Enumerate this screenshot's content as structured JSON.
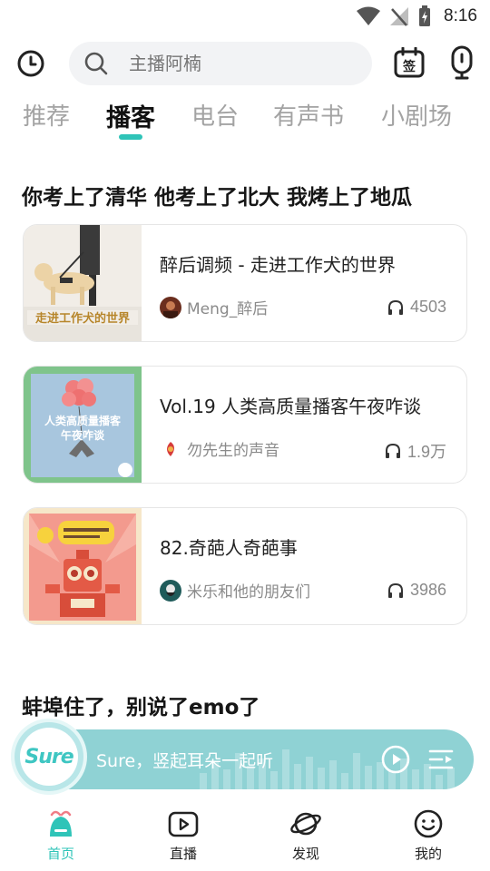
{
  "status_bar": {
    "time": "8:16"
  },
  "search": {
    "placeholder": "主播阿楠"
  },
  "header": {
    "sign_icon_text": "签"
  },
  "tabs": [
    {
      "label": "推荐",
      "active": false
    },
    {
      "label": "播客",
      "active": true
    },
    {
      "label": "电台",
      "active": false
    },
    {
      "label": "有声书",
      "active": false
    },
    {
      "label": "小剧场",
      "active": false
    }
  ],
  "sections": [
    {
      "title": "你考上了清华 他考上了北大 我烤上了地瓜",
      "items": [
        {
          "title": "醉后调频 - 走进工作犬的世界",
          "author": "Meng_醉后",
          "plays": "4503",
          "cover_text": "走进工作犬的世界"
        },
        {
          "title": "Vol.19 人类高质量播客午夜咋谈",
          "author": "勿先生的声音",
          "plays": "1.9万",
          "cover_text": "人类高质量播客午夜咋谈"
        },
        {
          "title": "82.奇葩人奇葩事",
          "author": "米乐和他的朋友们",
          "plays": "3986",
          "cover_text": ""
        }
      ]
    },
    {
      "title": "蚌埠住了，别说了emo了",
      "items": []
    }
  ],
  "player": {
    "logo_text": "Sure",
    "text": "Sure，竖起耳朵一起听"
  },
  "bottom_nav": [
    {
      "label": "首页",
      "icon": "home-icon",
      "active": true
    },
    {
      "label": "直播",
      "icon": "live-icon",
      "active": false
    },
    {
      "label": "发现",
      "icon": "planet-icon",
      "active": false
    },
    {
      "label": "我的",
      "icon": "smile-icon",
      "active": false
    }
  ],
  "colors": {
    "accent": "#2fc4b8",
    "player_bg": "#8fd2d4",
    "muted": "#a3a3a3"
  }
}
